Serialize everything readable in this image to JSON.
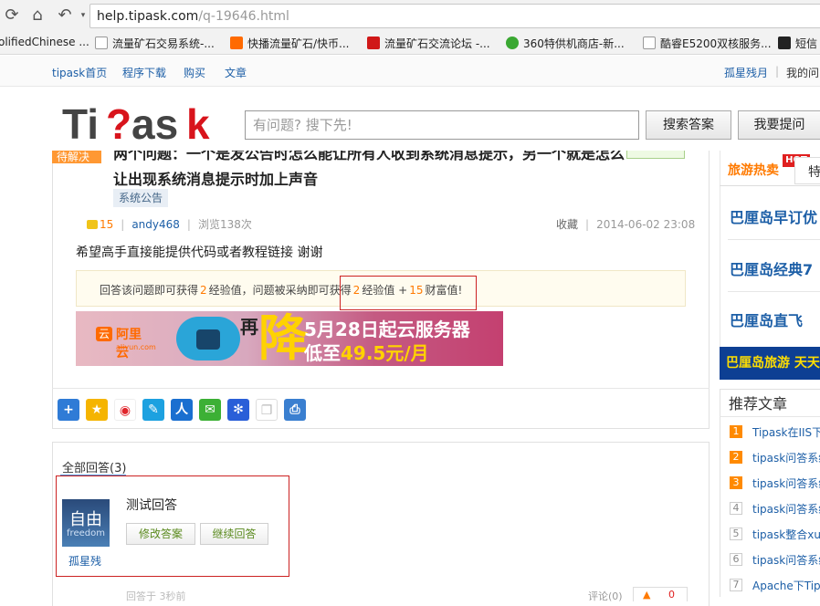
{
  "browser": {
    "url_host": "help.tipask.com",
    "url_path": "/q-19646.html",
    "bookmarks": [
      {
        "label": "olifiedChinese ...",
        "icon": "none"
      },
      {
        "label": "流量矿石交易系统-...",
        "icon": "page-icon"
      },
      {
        "label": "快播流量矿石/快币...",
        "icon": "taobao-icon"
      },
      {
        "label": "流量矿石交流论坛 -...",
        "icon": "forum-icon"
      },
      {
        "label": "360特供机商店-新...",
        "icon": "360-icon"
      },
      {
        "label": "酷睿E5200双核服务...",
        "icon": "page-icon"
      },
      {
        "label": "短信",
        "icon": "dark-icon"
      }
    ]
  },
  "site_nav": {
    "items": [
      "tipask首页",
      "程序下载",
      "购买",
      "文章"
    ],
    "user": "孤星残月",
    "my_questions": "我的问"
  },
  "header": {
    "logo_text": "TiPask",
    "search_placeholder": "有问题? 搜下先!",
    "search_button": "搜索答案",
    "ask_button": "我要提问"
  },
  "question": {
    "status": "待解决",
    "title": "两个问题：一个是发公告时怎么能让所有人收到系统消息提示，另一个就是怎么让出现系统消息提示时加上声音",
    "tag": "系统公告",
    "reward": "15",
    "author": "andy468",
    "views": "浏览138次",
    "collect": "收藏",
    "date": "2014-06-02 23:08",
    "body": "希望高手直接能提供代码或者教程链接 谢谢",
    "reward_text_1": "回答该问题即可获得",
    "reward_num_1": "2",
    "reward_text_2": "经验值，问题被采纳即可获得",
    "reward_num_2": "2",
    "reward_text_3": "经验值 +",
    "reward_num_3": "15",
    "reward_text_4": "财富值!"
  },
  "ad": {
    "brand": "阿里云",
    "brand_sub": "aliyun.com",
    "zai": "再",
    "jiang": "降",
    "line1": "5月28日起云服务器",
    "line2_a": "低至",
    "line2_b": "49.5元/月"
  },
  "share_icons": [
    "add-share-icon",
    "favorite-star-icon",
    "weibo-icon",
    "tencent-weibo-icon",
    "renren-icon",
    "wechat-icon",
    "baidu-paw-icon",
    "copy-icon",
    "print-icon"
  ],
  "answers": {
    "count_label": "全部回答(3)",
    "items": [
      {
        "avatar_big": "自由",
        "avatar_small": "freedom",
        "user": "孤星残",
        "content": "测试回答",
        "edit_button": "修改答案",
        "continue_button": "继续回答",
        "time": "回答于 3秒前",
        "comment": "评论(0)",
        "votes": "0"
      }
    ]
  },
  "sidebar": {
    "travel_title": "旅游热卖",
    "hot_badge": "HOT",
    "tab_right": "特",
    "links": [
      "巴厘岛早订优",
      "巴厘岛经典7",
      "巴厘岛直飞"
    ],
    "banner": "巴厘岛旅游  天天",
    "rec_title": "推荐文章",
    "rec_items": [
      {
        "num": "1",
        "text": "Tipask在IIS下"
      },
      {
        "num": "2",
        "text": "tipask问答系统"
      },
      {
        "num": "3",
        "text": "tipask问答系统"
      },
      {
        "num": "4",
        "text": "tipask问答系统"
      },
      {
        "num": "5",
        "text": "tipask整合xun"
      },
      {
        "num": "6",
        "text": "tipask问答系统"
      },
      {
        "num": "7",
        "text": "Apache下Tipa"
      }
    ]
  }
}
